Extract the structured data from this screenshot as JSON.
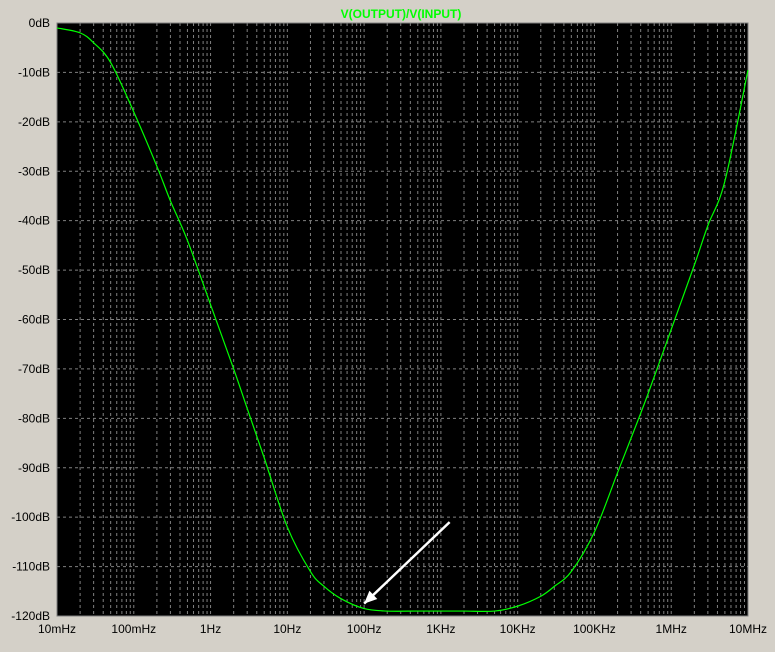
{
  "chart_data": {
    "type": "line",
    "title": "V(OUTPUT)/V(INPUT)",
    "x_scale": "log",
    "x_ticks": [
      "10mHz",
      "100mHz",
      "1Hz",
      "10Hz",
      "100Hz",
      "1KHz",
      "10KHz",
      "100KHz",
      "1MHz",
      "10MHz"
    ],
    "xlim": [
      0.01,
      10000000
    ],
    "y_ticks": [
      "0dB",
      "-10dB",
      "-20dB",
      "-30dB",
      "-40dB",
      "-50dB",
      "-60dB",
      "-70dB",
      "-80dB",
      "-90dB",
      "-100dB",
      "-110dB",
      "-120dB"
    ],
    "ylim": [
      -120,
      0
    ],
    "grid": true,
    "series": [
      {
        "name": "V(OUTPUT)/V(INPUT)",
        "color": "#00ff00",
        "x": [
          0.01,
          0.02,
          0.03,
          0.05,
          0.1,
          0.2,
          0.3,
          0.5,
          1,
          2,
          3,
          5,
          10,
          20,
          30,
          50,
          100,
          200,
          500,
          1000,
          2000,
          5000,
          10000,
          20000,
          30000,
          50000,
          100000,
          200000,
          300000,
          500000,
          1000000,
          2000000,
          3000000,
          5000000,
          10000000
        ],
        "y": [
          -1,
          -2,
          -4,
          -8,
          -18,
          -29,
          -36,
          -44,
          -57,
          -70,
          -78,
          -88,
          -102,
          -111,
          -114,
          -116.5,
          -118.5,
          -119,
          -119,
          -119,
          -119,
          -119,
          -118,
          -116,
          -114,
          -111,
          -103,
          -91,
          -84,
          -75,
          -62,
          -49,
          -41,
          -32,
          -9.5
        ]
      }
    ],
    "annotations": [
      {
        "type": "arrow",
        "color": "#ffffff",
        "from": [
          1300,
          -101
        ],
        "to": [
          100,
          -117.5
        ]
      }
    ],
    "colors": {
      "background": "#000000",
      "axis_text": "#000000",
      "title": "#00ff00",
      "grid": "#808080",
      "frame": "#d4d0c8"
    }
  }
}
